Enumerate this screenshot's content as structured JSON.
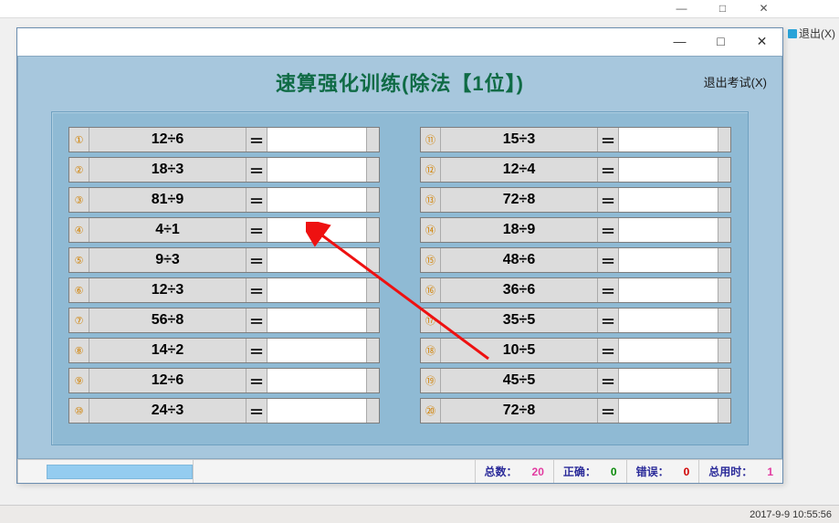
{
  "parent": {
    "min": "—",
    "max": "□",
    "close": "✕",
    "exit_label": "退出(X)"
  },
  "modal": {
    "min": "—",
    "max": "□",
    "close": "✕"
  },
  "title": "速算强化训练(除法【1位】)",
  "exit_exam": "退出考试(X)",
  "left": [
    {
      "n": "①",
      "expr": "12÷6"
    },
    {
      "n": "②",
      "expr": "18÷3"
    },
    {
      "n": "③",
      "expr": "81÷9"
    },
    {
      "n": "④",
      "expr": "4÷1"
    },
    {
      "n": "⑤",
      "expr": "9÷3"
    },
    {
      "n": "⑥",
      "expr": "12÷3"
    },
    {
      "n": "⑦",
      "expr": "56÷8"
    },
    {
      "n": "⑧",
      "expr": "14÷2"
    },
    {
      "n": "⑨",
      "expr": "12÷6"
    },
    {
      "n": "⑩",
      "expr": "24÷3"
    }
  ],
  "right": [
    {
      "n": "⑪",
      "expr": "15÷3"
    },
    {
      "n": "⑫",
      "expr": "12÷4"
    },
    {
      "n": "⑬",
      "expr": "72÷8"
    },
    {
      "n": "⑭",
      "expr": "18÷9"
    },
    {
      "n": "⑮",
      "expr": "48÷6"
    },
    {
      "n": "⑯",
      "expr": "36÷6"
    },
    {
      "n": "⑰",
      "expr": "35÷5"
    },
    {
      "n": "⑱",
      "expr": "10÷5"
    },
    {
      "n": "⑲",
      "expr": "45÷5"
    },
    {
      "n": "⑳",
      "expr": "72÷8"
    }
  ],
  "eq": "＝",
  "status": {
    "total_label": "总数：",
    "total_value": "20",
    "correct_label": "正确：",
    "correct_value": "0",
    "wrong_label": "错误：",
    "wrong_value": "0",
    "time_label": "总用时：",
    "time_value": "1"
  },
  "timestamp": "2017-9-9 10:55:56"
}
